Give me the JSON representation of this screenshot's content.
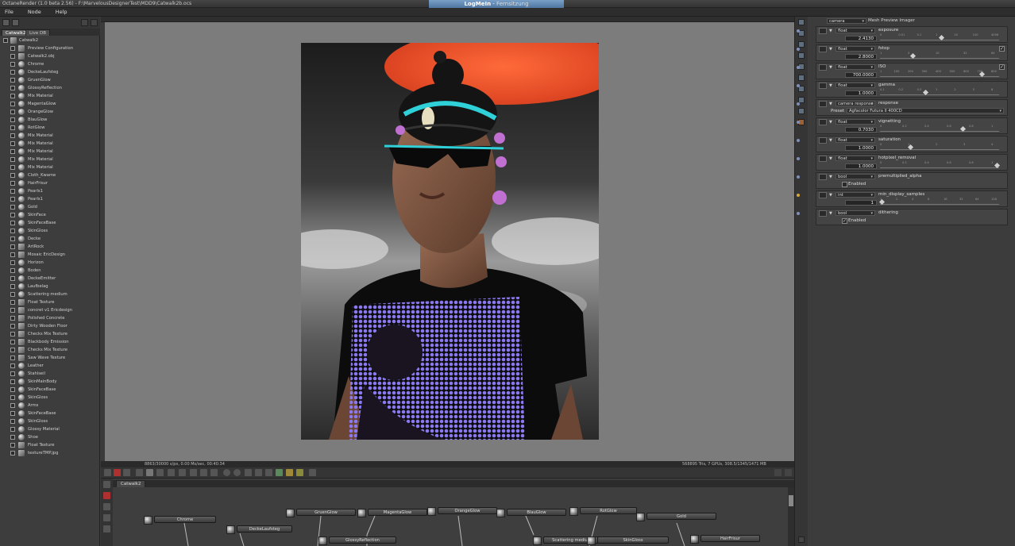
{
  "window": {
    "title": "OctaneRender (1.0 beta 2.56) - F:\\MarvelousDesignerTest\\MDD9\\Catwalk2b.ocs",
    "remote_app": "LogMeIn",
    "remote_session": "Fernsitzung"
  },
  "menu": [
    "File",
    "Node",
    "Help"
  ],
  "left_panel": {
    "tabs": [
      "Catwalk2",
      "Live DB"
    ],
    "root": "Catwalk2",
    "items": [
      {
        "label": "Preview Configuration",
        "icon": "config-icon"
      },
      {
        "label": "Catwalk2.obj",
        "icon": "mesh-icon"
      },
      {
        "label": "Chrome",
        "icon": "material-icon"
      },
      {
        "label": "DeckeLaufsteg",
        "icon": "material-icon"
      },
      {
        "label": "GruenGlow",
        "icon": "material-icon"
      },
      {
        "label": "GlossyReflection",
        "icon": "material-icon"
      },
      {
        "label": "Mix Material",
        "icon": "material-icon"
      },
      {
        "label": "MagentaGlow",
        "icon": "material-icon"
      },
      {
        "label": "OrangeGlow",
        "icon": "material-icon"
      },
      {
        "label": "BlauGlow",
        "icon": "material-icon"
      },
      {
        "label": "RotGlow",
        "icon": "material-icon"
      },
      {
        "label": "Mix Material",
        "icon": "material-icon"
      },
      {
        "label": "Mix Material",
        "icon": "material-icon"
      },
      {
        "label": "Mix Material",
        "icon": "material-icon"
      },
      {
        "label": "Mix Material",
        "icon": "material-icon"
      },
      {
        "label": "Mix Material",
        "icon": "material-icon"
      },
      {
        "label": "Cloth_Kwame",
        "icon": "material-icon"
      },
      {
        "label": "HairFrisur",
        "icon": "material-icon"
      },
      {
        "label": "Pearls1",
        "icon": "material-icon"
      },
      {
        "label": "Pearls1",
        "icon": "material-icon"
      },
      {
        "label": "Gold",
        "icon": "material-icon"
      },
      {
        "label": "SkinFace",
        "icon": "material-icon"
      },
      {
        "label": "SkinFaceBase",
        "icon": "material-icon"
      },
      {
        "label": "SkinGloss",
        "icon": "material-icon"
      },
      {
        "label": "Decke",
        "icon": "material-icon"
      },
      {
        "label": "ArtRock",
        "icon": "texture-icon"
      },
      {
        "label": "Mosaic EricDesign",
        "icon": "texture-icon"
      },
      {
        "label": "Horizon",
        "icon": "material-icon"
      },
      {
        "label": "Boden",
        "icon": "material-icon"
      },
      {
        "label": "DeckeEmitter",
        "icon": "material-icon"
      },
      {
        "label": "Laufbelag",
        "icon": "material-icon"
      },
      {
        "label": "Scattering medium",
        "icon": "material-icon"
      },
      {
        "label": "Float Texture",
        "icon": "texture-icon"
      },
      {
        "label": "concret v1 Ericdesign",
        "icon": "texture-icon"
      },
      {
        "label": "Polished Concrete",
        "icon": "texture-icon"
      },
      {
        "label": "Dirty Wooden Floor",
        "icon": "texture-icon"
      },
      {
        "label": "Checks Mix Texture",
        "icon": "texture-icon"
      },
      {
        "label": "Blackbody Emission",
        "icon": "texture-icon"
      },
      {
        "label": "Checks Mix Texture",
        "icon": "texture-icon"
      },
      {
        "label": "Saw Wave Texture",
        "icon": "texture-icon"
      },
      {
        "label": "Leather",
        "icon": "material-icon"
      },
      {
        "label": "Stahlseil",
        "icon": "material-icon"
      },
      {
        "label": "SkinMainBody",
        "icon": "material-icon"
      },
      {
        "label": "SkinFaceBase",
        "icon": "material-icon"
      },
      {
        "label": "SkinGloss",
        "icon": "material-icon"
      },
      {
        "label": "Arms",
        "icon": "material-icon"
      },
      {
        "label": "SkinFaceBase",
        "icon": "material-icon"
      },
      {
        "label": "SkinGloss",
        "icon": "material-icon"
      },
      {
        "label": "Glossy Material",
        "icon": "material-icon"
      },
      {
        "label": "Shoe",
        "icon": "material-icon"
      },
      {
        "label": "Float Texture",
        "icon": "texture-icon"
      },
      {
        "label": "textureTMP.jpg",
        "icon": "texture-icon"
      }
    ]
  },
  "viewport": {
    "status_left": "8863/30000 s/px, 0.00 Ms/sec, 00:40:34",
    "status_right": "568895 Tris, 7 GPUs, 308.5/1345/1471 MB"
  },
  "node_graph": {
    "tab": "Catwalk2",
    "nodes": [
      "Chrome",
      "DeckeLaufsteg",
      "GruenGlow",
      "MagentaGlow",
      "OrangeGlow",
      "BlauGlow",
      "RotGlow",
      "Gold",
      "GlossyReflection",
      "Scattering medium",
      "SkinGloss",
      "HairFrisur"
    ]
  },
  "inspector": {
    "node_type": "camera",
    "node_name": "Mesh Preview Imager",
    "params": [
      {
        "type": "float",
        "name": "exposure",
        "value": "2.4130",
        "ticks": [
          "0",
          "0.01",
          "0.1",
          "1",
          "10",
          "100",
          "4096"
        ],
        "level": 0.52
      },
      {
        "type": "float",
        "name": "fstop",
        "value": "2.8000",
        "ticks": [
          "1",
          "3",
          "10",
          "32",
          "64"
        ],
        "level": 0.27,
        "check": "✓"
      },
      {
        "type": "float",
        "name": "ISO",
        "value": "700.0000",
        "ticks": [
          "1",
          "100",
          "200",
          "300",
          "400",
          "500",
          "600",
          "700",
          "800"
        ],
        "level": 0.87,
        "check": "✓"
      },
      {
        "type": "float",
        "name": "gamma",
        "value": "1.0000",
        "ticks": [
          "0.1",
          "0.2",
          "0.5",
          "1",
          "2",
          "5",
          "8"
        ],
        "level": 0.38
      },
      {
        "type": "camera response",
        "name": "response",
        "preset_label": "Preset",
        "preset": "Agfacolor Futura II 400CD"
      },
      {
        "type": "float",
        "name": "vignetting",
        "value": "0.7030",
        "ticks": [
          "0",
          "0.2",
          "0.4",
          "0.6",
          "0.8",
          "1"
        ],
        "level": 0.7
      },
      {
        "type": "float",
        "name": "saturation",
        "value": "1.0000",
        "ticks": [
          "0",
          "1",
          "2",
          "3",
          "4"
        ],
        "level": 0.25
      },
      {
        "type": "float",
        "name": "hotpixel_removal",
        "value": "1.0000",
        "ticks": [
          "0",
          "0.2",
          "0.4",
          "0.6",
          "0.8",
          "1"
        ],
        "level": 1.0
      },
      {
        "type": "bool",
        "name": "premultiplied_alpha",
        "enabled_label": "Enabled",
        "checked": ""
      },
      {
        "type": "int",
        "name": "min_display_samples",
        "value": "1",
        "ticks": [
          "1",
          "2",
          "4",
          "8",
          "16",
          "32",
          "64",
          "128"
        ],
        "level": 0.0
      },
      {
        "type": "bool",
        "name": "dithering",
        "enabled_label": "Enabled",
        "checked": "✓"
      }
    ]
  }
}
